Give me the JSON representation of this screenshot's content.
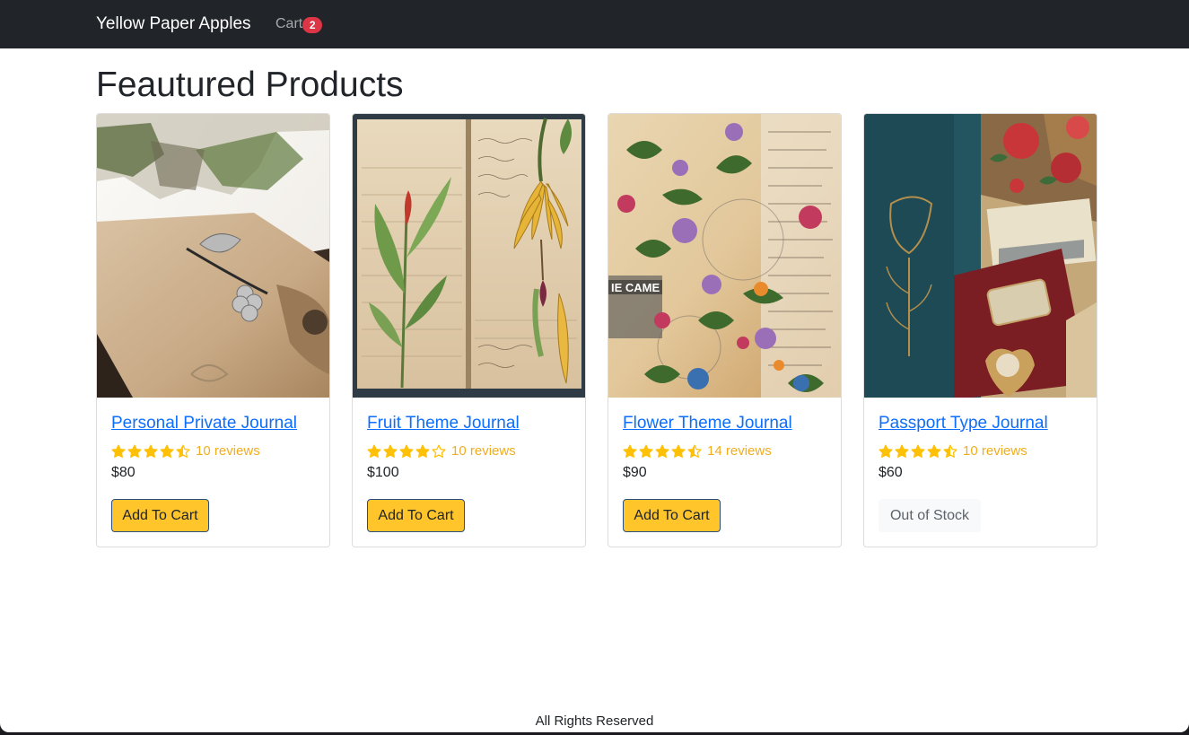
{
  "navbar": {
    "brand": "Yellow Paper Apples",
    "cart_label": "Cart",
    "cart_count": "2"
  },
  "main": {
    "title": "Feautured Products"
  },
  "products": [
    {
      "name": "Personal Private Journal",
      "rating": 4.5,
      "reviews": "10 reviews",
      "price": "$80",
      "action": "Add To Cart",
      "in_stock": true,
      "image": "leather-journal"
    },
    {
      "name": "Fruit Theme Journal",
      "rating": 4,
      "reviews": "10 reviews",
      "price": "$100",
      "action": "Add To Cart",
      "in_stock": true,
      "image": "banana-botanical-journal"
    },
    {
      "name": "Flower Theme Journal",
      "rating": 4.5,
      "reviews": "14 reviews",
      "price": "$90",
      "action": "Add To Cart",
      "in_stock": true,
      "image": "floral-collage-journal"
    },
    {
      "name": "Passport Type Journal",
      "rating": 4.5,
      "reviews": "10 reviews",
      "price": "$60",
      "action": "Out of Stock",
      "in_stock": false,
      "image": "vintage-passport-journal"
    }
  ],
  "footer": {
    "text": "All Rights Reserved"
  },
  "colors": {
    "navbar_bg": "#212529",
    "star": "#ffc107",
    "link": "#0d6efd",
    "button": "#ffc52a",
    "badge": "#dc3545"
  }
}
